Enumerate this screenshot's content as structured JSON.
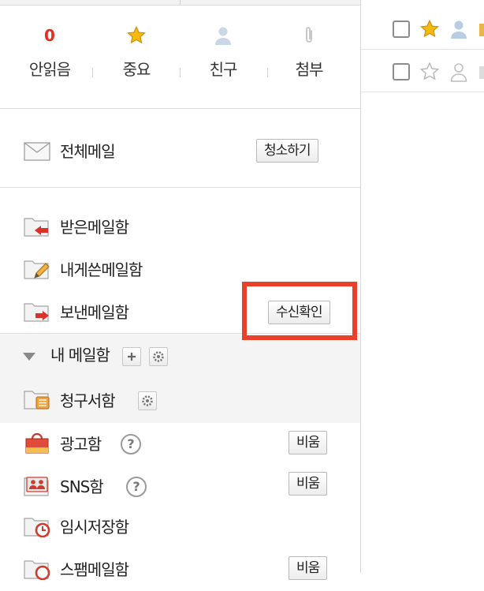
{
  "stats": [
    {
      "count": "0",
      "label": "안읽음",
      "icon": "unread-count"
    },
    {
      "count": "",
      "label": "중요",
      "icon": "star-icon"
    },
    {
      "count": "",
      "label": "친구",
      "icon": "person-icon"
    },
    {
      "count": "",
      "label": "첨부",
      "icon": "paperclip-icon"
    }
  ],
  "all_mail": {
    "label": "전체메일",
    "button": "청소하기",
    "icon": "envelope-icon"
  },
  "folders": [
    {
      "label": "받은메일함",
      "icon": "inbox-folder-icon"
    },
    {
      "label": "내게쓴메일함",
      "icon": "self-folder-icon"
    },
    {
      "label": "보낸메일함",
      "icon": "sent-folder-icon",
      "button": "수신확인"
    }
  ],
  "my_mailbox": {
    "label": "내 메일함",
    "folders": [
      {
        "label": "청구서함",
        "icon": "bill-folder-icon"
      }
    ]
  },
  "special_folders": [
    {
      "label": "광고함",
      "button": "비움",
      "icon": "ad-folder-icon"
    },
    {
      "label": "SNS함",
      "button": "비움",
      "icon": "sns-folder-icon"
    },
    {
      "label": "임시저장함",
      "icon": "draft-folder-icon"
    },
    {
      "label": "스팸메일함",
      "button": "비움",
      "icon": "spam-folder-icon"
    }
  ],
  "help_glyph": "?",
  "colors": {
    "accent_red": "#e0301e",
    "highlight": "#e8412a",
    "star": "#f5b90f"
  },
  "message_rows": [
    {
      "starred": true,
      "icon": "star-filled"
    },
    {
      "starred": false,
      "icon": "star-outline"
    }
  ]
}
